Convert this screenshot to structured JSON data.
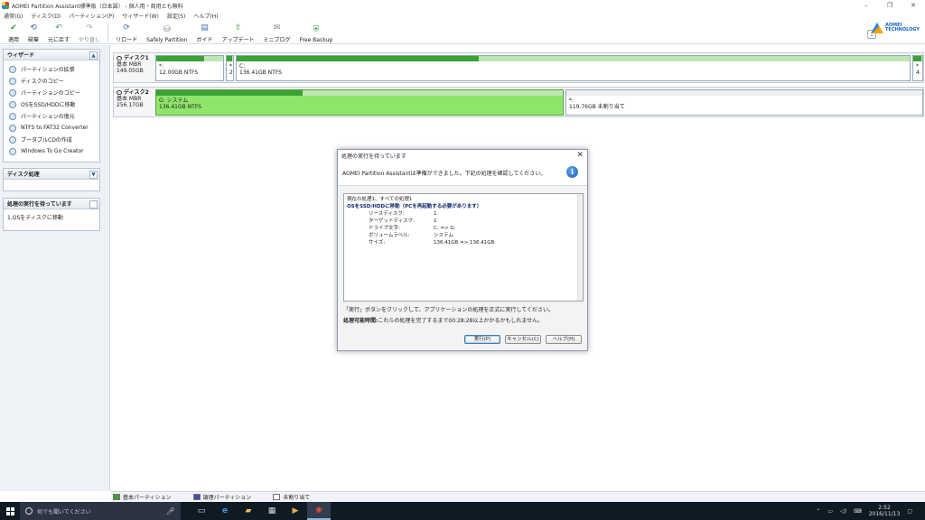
{
  "window": {
    "title": "AOMEI Partition Assistant標準版（日本語） - 個人用・商用とも無料",
    "minimize": "–",
    "maximize": "❐",
    "close": "✕"
  },
  "menu": [
    "通常(G)",
    "ディスク(D)",
    "パーティション(P)",
    "ウィザード(W)",
    "設定(S)",
    "ヘルプ(H)"
  ],
  "toolbar": {
    "apply": "適用",
    "discard": "破棄",
    "undo": "元に戻す",
    "redo": "やり直し",
    "reload": "リロード",
    "safely_partition": "Safely Partition",
    "guide": "ガイド",
    "update": "アップデート",
    "miniblog": "ミニブログ",
    "free_backup": "Free Backup",
    "brand": "AOMEI TECHNOLOGY"
  },
  "wizard_panel": {
    "title": "ウィザード",
    "items": [
      "パーティションの拡張",
      "ディスクのコピー",
      "パーティションのコピー",
      "OSをSSD/HDDに移動",
      "パーティションの復元",
      "NTFS to FAT32 Converter",
      "ブータブルCDの作成",
      "Windows To Go Creator"
    ]
  },
  "disk_panel": {
    "title": "ディスク処理"
  },
  "pending_panel": {
    "title": "処理の実行を待っています",
    "items": [
      "1.OSをディスクに移動"
    ]
  },
  "disks": [
    {
      "name": "ディスク1",
      "type": "基本 MBR",
      "size": "149.05GB",
      "partitions": [
        {
          "label": "*:",
          "info": "12.00GB NTFS",
          "used_fraction": 0.72
        },
        {
          "label": "*",
          "info": "2",
          "used_fraction": 0.9
        },
        {
          "label": "C:",
          "info": "136.41GB NTFS",
          "used_fraction": 0.36
        },
        {
          "label": "*",
          "info": "4.",
          "used_fraction": 0.9
        }
      ]
    },
    {
      "name": "ディスク2",
      "type": "基本 MBR",
      "size": "256.17GB",
      "partitions": [
        {
          "label": "G: システム",
          "info": "136.41GB NTFS",
          "used_fraction": 0.36
        },
        {
          "label": "*:",
          "info": "119.76GB 未割り当て",
          "used_fraction": 0
        }
      ]
    }
  ],
  "legend": [
    "基本パーティション",
    "論理パーティション",
    "未割り当て"
  ],
  "colors": {
    "primary_partition": "#3aa336",
    "logical_partition": "#3a4fb0",
    "unallocated": "#ffffff",
    "selected_partition": "#8ee56a"
  },
  "dialog": {
    "title": "処理の実行を待っています",
    "header": "AOMEI Partition Assistantは準備ができました。下記の処理を確認してください。",
    "summary": "現在の処理1、すべての処理1",
    "operation": "OSをSSD/HDDに移動（PCを再起動する必要があります）",
    "details": [
      {
        "key": "ソースディスク:",
        "value": "1"
      },
      {
        "key": "ターゲットディスク:",
        "value": "1"
      },
      {
        "key": "ドライブ文字:",
        "value": "C: => G:"
      },
      {
        "key": "ボリュームラベル:",
        "value": "システム"
      },
      {
        "key": "サイズ:",
        "value": "136.41GB => 136.41GB"
      }
    ],
    "note": "「実行」ボタンをクリックして、アプリケーションの処理を正式に実行してください。",
    "time_label": "処理可能時間:",
    "time_text": "これらの処理を完了するまで00:28:28以上かかるかもしれません。",
    "buttons": {
      "execute": "実行(P)",
      "cancel": "キャンセル(C)",
      "help": "ヘルプ(H)"
    }
  },
  "taskbar": {
    "search_placeholder": "何でも聞いてください",
    "time": "2:52",
    "date": "2016/11/13"
  }
}
